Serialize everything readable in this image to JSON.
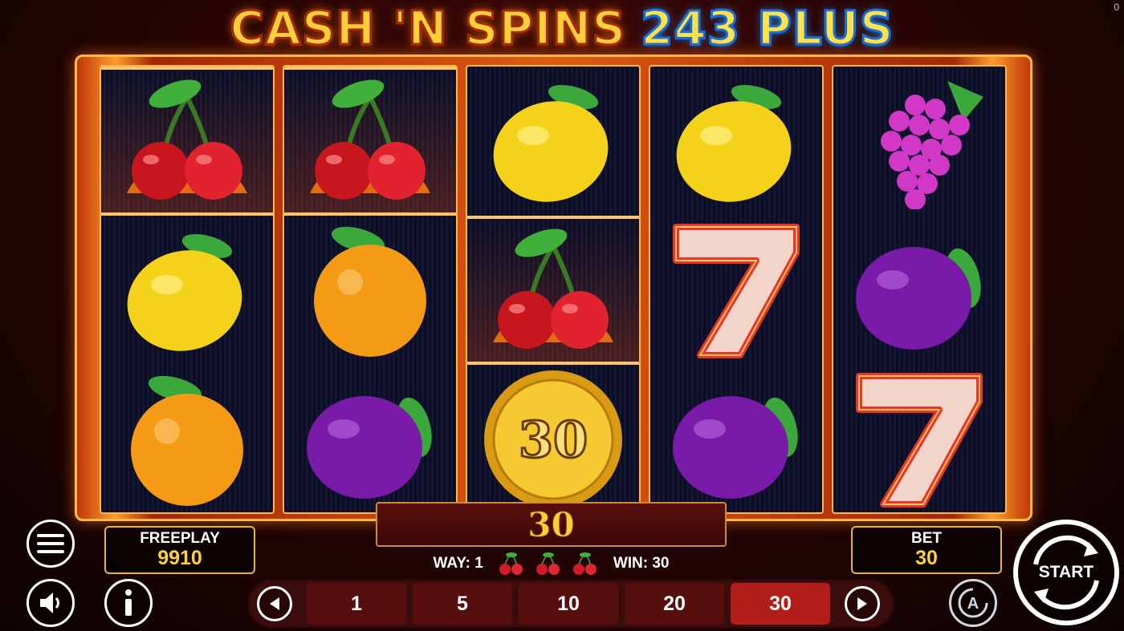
{
  "corner_counter": "0",
  "title": {
    "part1": "CASH 'N SPINS",
    "part2": "243 PLUS"
  },
  "reels": [
    [
      "cherries-fire",
      "lemon",
      "orange"
    ],
    [
      "cherries-fire",
      "orange",
      "plum"
    ],
    [
      "lemon",
      "cherries-fire",
      "coin"
    ],
    [
      "lemon",
      "seven",
      "plum"
    ],
    [
      "grapes",
      "plum",
      "seven"
    ]
  ],
  "coin_value": "30",
  "win_display": "30",
  "freeplay": {
    "label": "FREEPLAY",
    "value": "9910"
  },
  "bet": {
    "label": "BET",
    "value": "30"
  },
  "way_line": {
    "way_label": "WAY: 1",
    "win_label": "WIN: 30"
  },
  "bet_options": [
    "1",
    "5",
    "10",
    "20",
    "30"
  ],
  "bet_selected": "30",
  "start_label": "START",
  "colors": {
    "gold": "#ffd23a",
    "frame": "#ffb84a",
    "active_bet": "#b21e1a"
  }
}
